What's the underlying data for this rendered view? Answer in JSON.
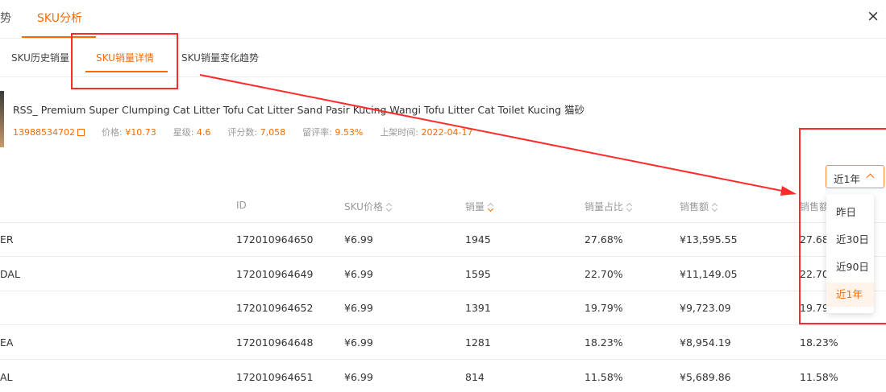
{
  "top_tabs": {
    "trend_partial": "势",
    "sku_analysis": "SKU分析"
  },
  "sub_tabs": {
    "history": "SKU历史销量",
    "detail": "SKU销量详情",
    "change_trend": "SKU销量变化趋势"
  },
  "product": {
    "title": "RSS_ Premium Super Clumping Cat Litter Tofu Cat Litter Sand Pasir Kucing Wangi Tofu Litter Cat Toilet Kucing 猫砂",
    "id": "13988534702",
    "price_label": "价格:",
    "price": "¥10.73",
    "rating_label": "星级:",
    "rating": "4.6",
    "reviews_label": "评分数:",
    "reviews": "7,058",
    "review_rate_label": "留评率:",
    "review_rate": "9.53%",
    "listed_label": "上架时间:",
    "listed": "2022-04-17"
  },
  "filter": {
    "selected": "近1年",
    "options": [
      "昨日",
      "近30日",
      "近90日",
      "近1年"
    ]
  },
  "table": {
    "headers": {
      "id": "ID",
      "price": "SKU价格",
      "sales": "销量",
      "share": "销量占比",
      "revenue": "销售额",
      "revenue_share": "销售額"
    },
    "rows": [
      {
        "name": "ER",
        "id": "172010964650",
        "price": "¥6.99",
        "sales": "1945",
        "share": "27.68%",
        "revenue": "¥13,595.55",
        "revenue_share": "27.68"
      },
      {
        "name": "DAL",
        "id": "172010964649",
        "price": "¥6.99",
        "sales": "1595",
        "share": "22.70%",
        "revenue": "¥11,149.05",
        "revenue_share": "22.70"
      },
      {
        "name": "",
        "id": "172010964652",
        "price": "¥6.99",
        "sales": "1391",
        "share": "19.79%",
        "revenue": "¥9,723.09",
        "revenue_share": "19.79"
      },
      {
        "name": "EA",
        "id": "172010964648",
        "price": "¥6.99",
        "sales": "1281",
        "share": "18.23%",
        "revenue": "¥8,954.19",
        "revenue_share": "18.23%"
      },
      {
        "name": "AL",
        "id": "172010964651",
        "price": "¥6.99",
        "sales": "814",
        "share": "11.58%",
        "revenue": "¥5,689.86",
        "revenue_share": "11.58%"
      }
    ]
  },
  "colors": {
    "accent": "#ff6a00",
    "annotation": "#ff2a2a"
  }
}
